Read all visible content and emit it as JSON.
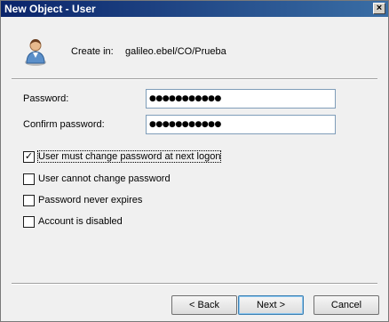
{
  "window": {
    "title": "New Object - User",
    "close_glyph": "×"
  },
  "header": {
    "icon": "user-icon",
    "create_label": "Create in:",
    "create_path": "galileo.ebel/CO/Prueba"
  },
  "form": {
    "password_label": "Password:",
    "password_value": "●●●●●●●●●●●",
    "confirm_label": "Confirm password:",
    "confirm_value": "●●●●●●●●●●●"
  },
  "options": [
    {
      "label": "User must change password at next logon",
      "checked": true,
      "check_glyph": "✓"
    },
    {
      "label": "User cannot change password",
      "checked": false
    },
    {
      "label": "Password never expires",
      "checked": false
    },
    {
      "label": "Account is disabled",
      "checked": false
    }
  ],
  "buttons": {
    "back": "< Back",
    "next": "Next >",
    "cancel": "Cancel"
  }
}
